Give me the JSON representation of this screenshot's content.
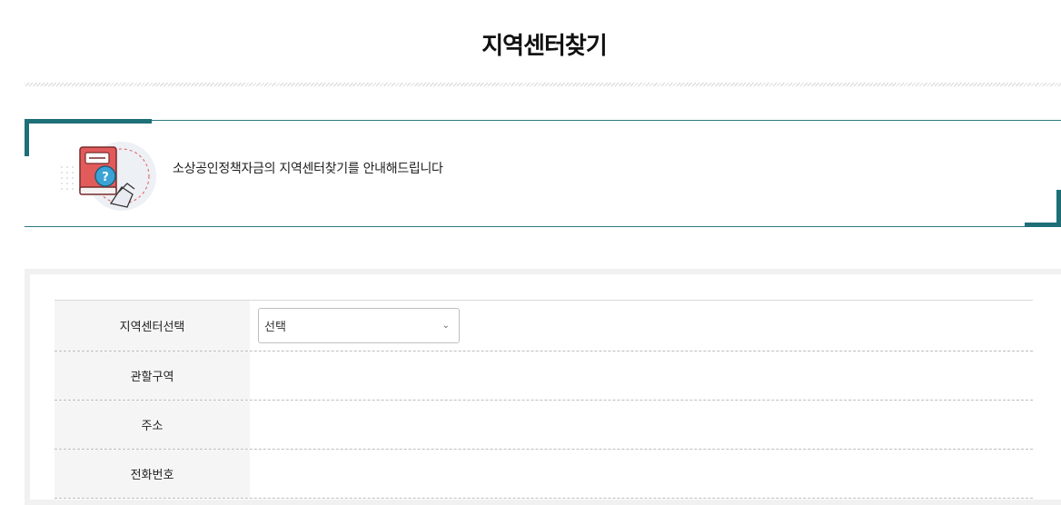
{
  "page": {
    "title": "지역센터찾기"
  },
  "notice": {
    "text": "소상공인정책자금의 지역센터찾기를 안내해드립니다",
    "icon": "book-handshake-question-icon"
  },
  "form": {
    "rows": [
      {
        "label": "지역센터선택",
        "type": "select",
        "value": "선택"
      },
      {
        "label": "관할구역",
        "value": ""
      },
      {
        "label": "주소",
        "value": ""
      },
      {
        "label": "전화번호",
        "value": ""
      }
    ]
  },
  "colors": {
    "accent": "#1e6f78",
    "header_bg": "#f5f5f5",
    "divider": "#bdbdbd"
  }
}
